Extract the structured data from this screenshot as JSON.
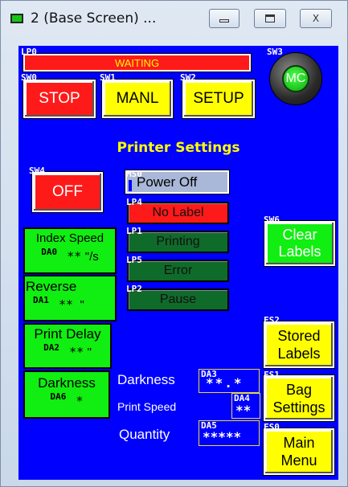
{
  "window": {
    "title": "2 (Base Screen) ...",
    "minimize_glyph": "▭",
    "maximize_glyph": "▣",
    "close_glyph": "X"
  },
  "panel": {
    "heading": "Printer Settings",
    "colors": {
      "background": "#0000fe",
      "red": "#ff1a1a",
      "yellow": "#ffff00",
      "green": "#11ee11",
      "dark_green": "#0f6b2a",
      "heading": "#ffff00"
    }
  },
  "status_lamp": {
    "tag": "LP0",
    "text": "WAITING"
  },
  "buttons": {
    "stop": {
      "tag": "SW0",
      "label": "STOP"
    },
    "manual": {
      "tag": "SW1",
      "label": "MANL"
    },
    "setup": {
      "tag": "SW2",
      "label": "SETUP"
    },
    "mc": {
      "tag": "SW3",
      "label": "MC"
    },
    "off": {
      "tag": "SW4",
      "label": "OFF"
    },
    "clear_labels": {
      "tag": "SW6",
      "label_line1": "Clear",
      "label_line2": "Labels"
    },
    "stored_labels": {
      "tag": "FS2",
      "label_line1": "Stored",
      "label_line2": "Labels"
    },
    "bag_settings": {
      "tag": "FS1",
      "label_line1": "Bag",
      "label_line2": "Settings"
    },
    "main_menu": {
      "tag": "FS0",
      "label_line1": "Main",
      "label_line2": "Menu"
    }
  },
  "power": {
    "tag": "MS0",
    "text": "Power Off"
  },
  "indicators": [
    {
      "tag": "LP4",
      "text": "No Label"
    },
    {
      "tag": "LP1",
      "text": "Printing"
    },
    {
      "tag": "LP5",
      "text": "Error"
    },
    {
      "tag": "LP2",
      "text": "Pause"
    }
  ],
  "params": [
    {
      "label": "Index Speed",
      "tag": "DA0",
      "value": "**",
      "unit": "\"/s"
    },
    {
      "label": "Reverse",
      "tag": "DA1",
      "value": "**",
      "unit": "\""
    },
    {
      "label": "Print Delay",
      "tag": "DA2",
      "value": "**",
      "unit": "\""
    },
    {
      "label": "Darkness",
      "tag": "DA6",
      "value": "*",
      "unit": ""
    }
  ],
  "readouts": [
    {
      "label": "Darkness",
      "tag": "DA3",
      "value": "**.*"
    },
    {
      "label": "Print Speed",
      "tag": "DA4",
      "value": "**"
    },
    {
      "label": "Quantity",
      "tag": "DA5",
      "value": "*****"
    }
  ]
}
